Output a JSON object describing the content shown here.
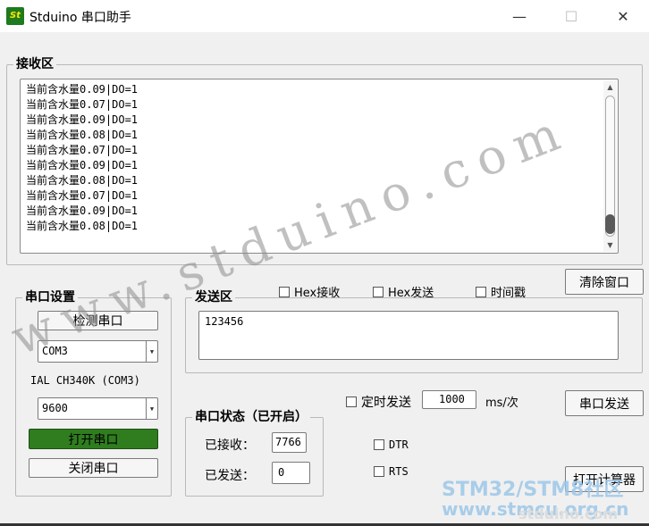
{
  "window": {
    "logo_text": "St",
    "title": "Stduino 串口助手",
    "min_glyph": "—",
    "max_glyph": "☐",
    "close_glyph": "✕"
  },
  "receive": {
    "legend": "接收区",
    "lines": [
      "当前含水量0.09|DO=1",
      "当前含水量0.07|DO=1",
      "当前含水量0.09|DO=1",
      "当前含水量0.08|DO=1",
      "当前含水量0.07|DO=1",
      "当前含水量0.09|DO=1",
      "当前含水量0.08|DO=1",
      "当前含水量0.07|DO=1",
      "当前含水量0.09|DO=1",
      "当前含水量0.08|DO=1"
    ]
  },
  "buttons": {
    "clear": "清除窗口",
    "send": "串口发送",
    "calculator": "打开计算器",
    "detect": "检测串口",
    "open": "打开串口",
    "close": "关闭串口"
  },
  "serial_settings": {
    "legend": "串口设置",
    "port": "COM3",
    "device": "IAL CH340K (COM3)",
    "baud": "9600"
  },
  "send": {
    "legend": "发送区",
    "hex_receive": "Hex接收",
    "hex_send": "Hex发送",
    "timestamp": "时间戳",
    "text": "123456",
    "timed_send": "定时发送",
    "interval": "1000",
    "interval_unit": "ms/次"
  },
  "status": {
    "legend": "串口状态（已开启）",
    "received_label": "已接收：",
    "received": "7766",
    "sent_label": "已发送：",
    "sent": "0"
  },
  "lines": {
    "dtr": "DTR",
    "rts": "RTS"
  },
  "watermark": {
    "text": "www.stduino.com",
    "site1": "STM32/STM8社区",
    "site2": "www.stmcu.org.cn",
    "site3": "stduino.com"
  }
}
